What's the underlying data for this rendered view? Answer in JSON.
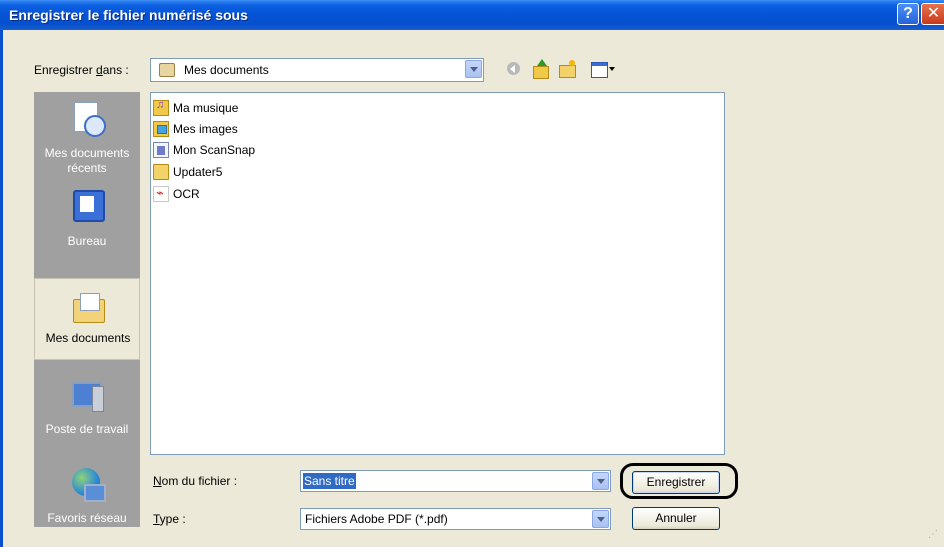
{
  "window": {
    "title": "Enregistrer le fichier numérisé sous",
    "help_glyph": "?",
    "close_glyph": "✕"
  },
  "toolbar": {
    "save_in_label_prefix": "Enregistrer ",
    "save_in_label_accel": "d",
    "save_in_label_suffix": "ans :",
    "save_in_value": "Mes documents",
    "icons": [
      "back-icon",
      "up-folder-icon",
      "new-folder-icon",
      "view-menu-icon"
    ]
  },
  "places": [
    {
      "label": "Mes documents récents",
      "icon": "recent-documents-icon",
      "selected": false
    },
    {
      "label": "Bureau",
      "icon": "desktop-icon",
      "selected": false
    },
    {
      "label": "Mes documents",
      "icon": "my-documents-icon",
      "selected": true
    },
    {
      "label": "Poste de travail",
      "icon": "my-computer-icon",
      "selected": false
    },
    {
      "label": "Favoris réseau",
      "icon": "network-places-icon",
      "selected": false
    }
  ],
  "files": [
    {
      "name": "Ma musique",
      "icon": "music-folder-icon"
    },
    {
      "name": "Mes images",
      "icon": "pictures-folder-icon"
    },
    {
      "name": "Mon ScanSnap",
      "icon": "scansnap-folder-icon"
    },
    {
      "name": "Updater5",
      "icon": "folder-icon"
    },
    {
      "name": "OCR",
      "icon": "pdf-file-icon"
    }
  ],
  "filename": {
    "label_accel": "N",
    "label_rest": "om du fichier :",
    "value": "Sans titre"
  },
  "filetype": {
    "label_accel": "T",
    "label_rest": "ype :",
    "value": "Fichiers Adobe PDF (*.pdf)"
  },
  "buttons": {
    "save": "Enregistrer",
    "cancel": "Annuler"
  },
  "colors": {
    "titlebar": "#0653d6",
    "dialog_bg": "#ece9d8",
    "places_bg": "#a0a0a0",
    "selection": "#316ac5"
  }
}
